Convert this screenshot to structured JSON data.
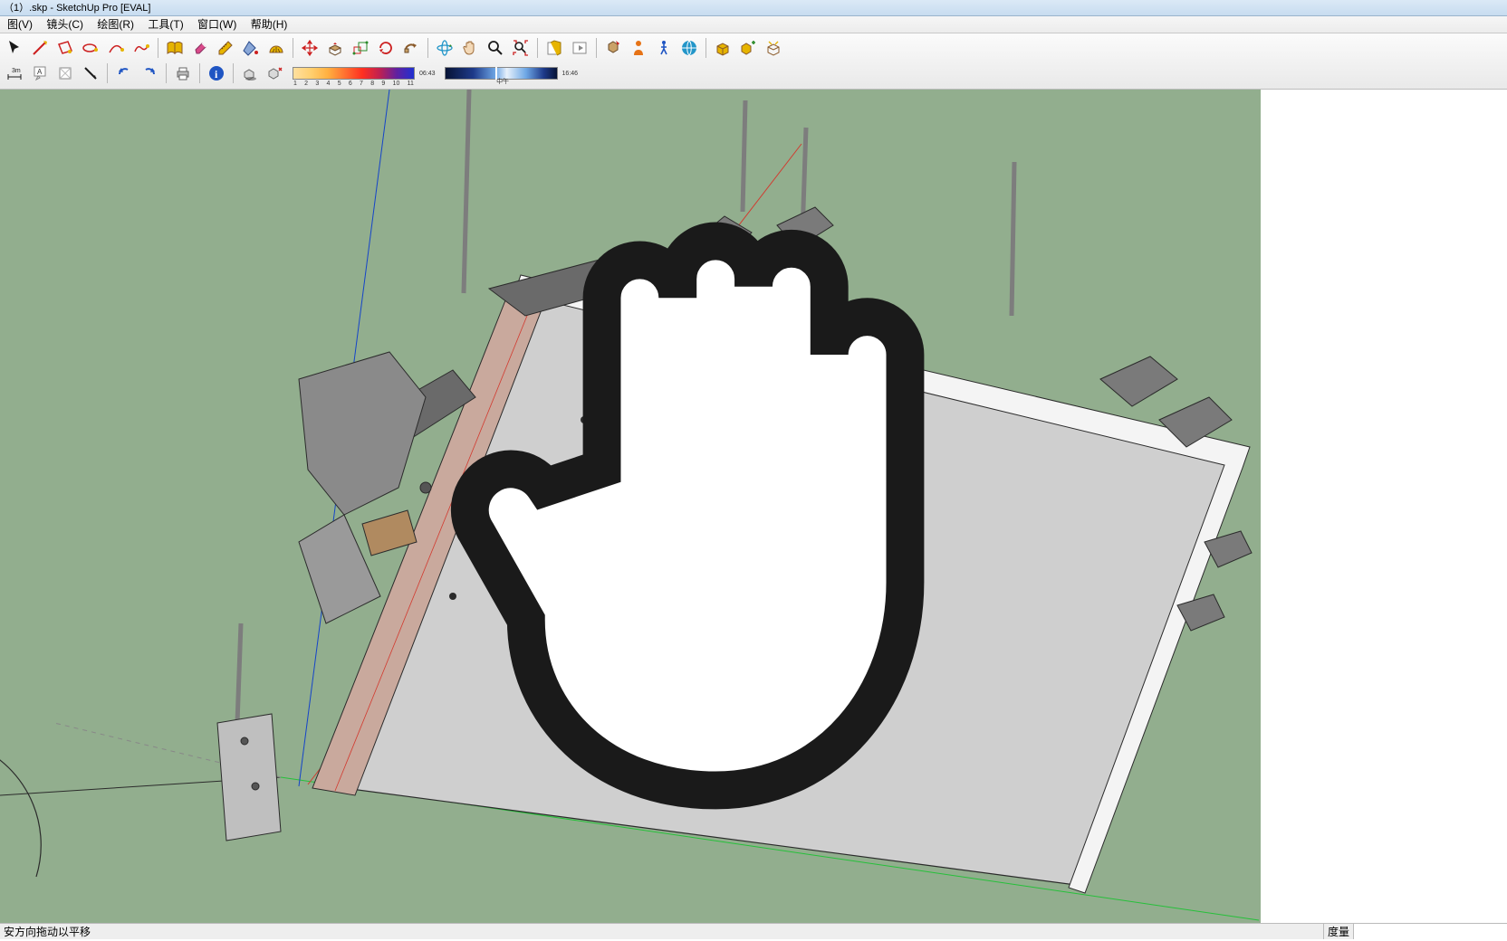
{
  "titlebar": {
    "text": "（1）.skp - SketchUp Pro [EVAL]"
  },
  "menu": {
    "items": [
      {
        "id": "view",
        "label": "图(V)"
      },
      {
        "id": "camera",
        "label": "镜头(C)"
      },
      {
        "id": "draw",
        "label": "绘图(R)"
      },
      {
        "id": "tools",
        "label": "工具(T)"
      },
      {
        "id": "window",
        "label": "窗口(W)"
      },
      {
        "id": "help",
        "label": "帮助(H)"
      }
    ]
  },
  "toolbar_row1": [
    "select-tool",
    "line-tool",
    "rectangle-tool",
    "circle-tool",
    "arc-tool",
    "polygon-tool",
    "sep",
    "eraser-tool",
    "tape-tool",
    "protractor-tool",
    "paint-bucket-tool",
    "text-tool",
    "sep",
    "move-tool",
    "pushpull-tool",
    "scale-tool",
    "rotate-tool",
    "offset-tool",
    "followme-tool",
    "sep",
    "orbit-tool",
    "pan-tool",
    "zoom-tool",
    "zoom-extents-tool",
    "sep",
    "new-file",
    "open-file",
    "sep",
    "place-component",
    "get-models",
    "share-model",
    "3d-warehouse",
    "sep",
    "outliner",
    "layers",
    "materials"
  ],
  "toolbar_row2": [
    "make-component",
    "make-group",
    "explode",
    "intersect",
    "section-plane",
    "sep",
    "undo",
    "redo",
    "sep",
    "print",
    "sep",
    "model-info",
    "sep",
    "shadow-toggle",
    "shadow-settings"
  ],
  "shadow": {
    "date_ticks": [
      "1",
      "2",
      "3",
      "4",
      "5",
      "6",
      "7",
      "8",
      "9",
      "10",
      "11"
    ],
    "time_start": "06:43",
    "time_mid": "中午",
    "time_end": "16:46"
  },
  "statusbar": {
    "hint": "安方向拖动以平移",
    "measure_label": "度量"
  },
  "icon_colors": {
    "red": "#cc2020",
    "orange": "#e67316",
    "yellow": "#e6b400",
    "green": "#2a8a2a",
    "blue": "#1f55c3",
    "cyan": "#2396c9",
    "purple": "#7a3bb0",
    "brown": "#8a5a2a",
    "pink": "#d94a8a",
    "black": "#1a1a1a",
    "grey": "#7a7a7a",
    "tan": "#caa268"
  }
}
